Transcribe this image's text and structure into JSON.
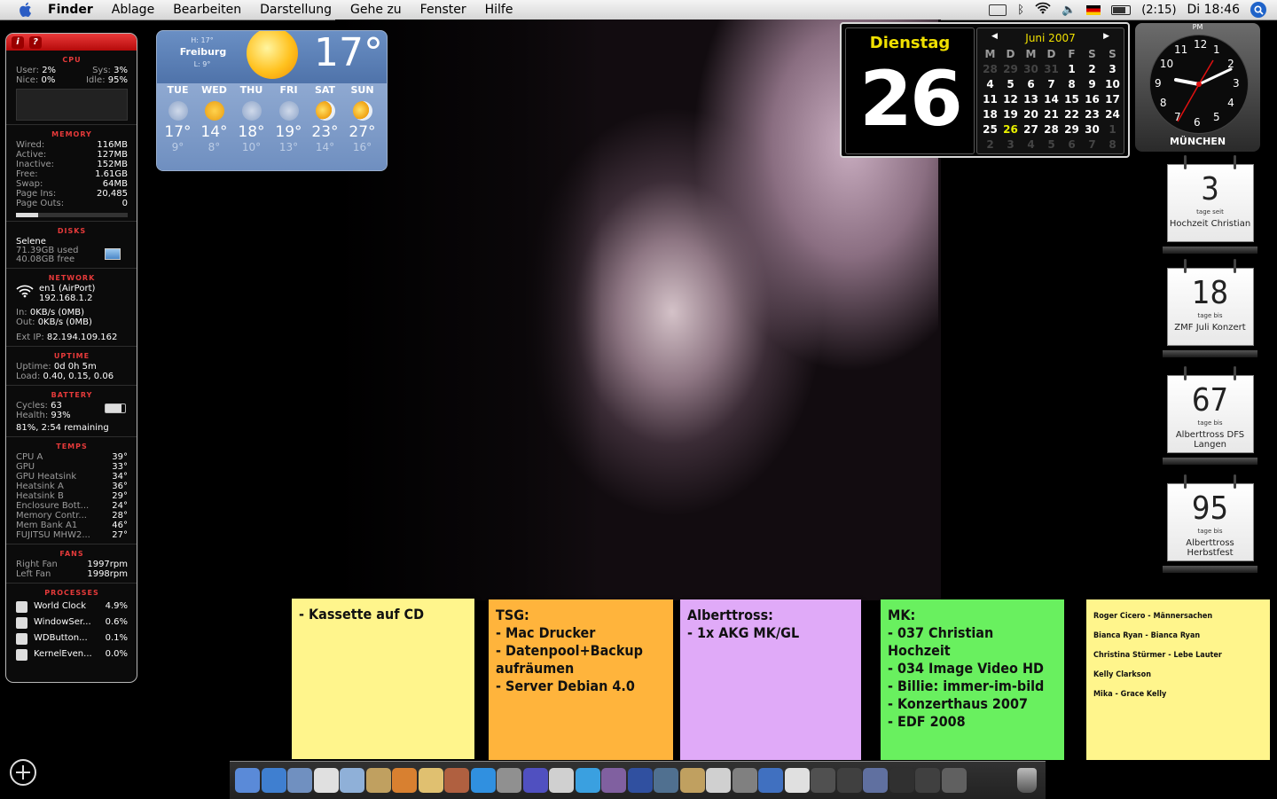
{
  "menubar": {
    "items": [
      "Finder",
      "Ablage",
      "Bearbeiten",
      "Darstellung",
      "Gehe zu",
      "Fenster",
      "Hilfe"
    ],
    "battery_time": "(2:15)",
    "clock": "Di 18:46"
  },
  "istat": {
    "cpu": {
      "title": "CPU",
      "user_label": "User:",
      "user": "2%",
      "sys_label": "Sys:",
      "sys": "3%",
      "nice_label": "Nice:",
      "nice": "0%",
      "idle_label": "Idle:",
      "idle": "95%"
    },
    "memory": {
      "title": "MEMORY",
      "rows": [
        {
          "label": "Wired:",
          "value": "116MB"
        },
        {
          "label": "Active:",
          "value": "127MB"
        },
        {
          "label": "Inactive:",
          "value": "152MB"
        },
        {
          "label": "Free:",
          "value": "1.61GB"
        },
        {
          "label": "Swap:",
          "value": "64MB"
        },
        {
          "label": "Page Ins:",
          "value": "20,485"
        },
        {
          "label": "Page Outs:",
          "value": "0"
        }
      ],
      "usage_fraction": 0.2
    },
    "disks": {
      "title": "DISKS",
      "name": "Selene",
      "used": "71.39GB used",
      "free": "40.08GB free"
    },
    "network": {
      "title": "NETWORK",
      "iface": "en1 (AirPort)",
      "ip": "192.168.1.2",
      "in_label": "In:",
      "in": "0KB/s (0MB)",
      "out_label": "Out:",
      "out": "0KB/s (0MB)",
      "ext_label": "Ext IP:",
      "ext": "82.194.109.162"
    },
    "uptime": {
      "title": "UPTIME",
      "uptime_label": "Uptime:",
      "uptime": "0d 0h 5m",
      "load_label": "Load:",
      "load": "0.40, 0.15, 0.06"
    },
    "battery": {
      "title": "BATTERY",
      "cycles_label": "Cycles:",
      "cycles": "63",
      "health_label": "Health:",
      "health": "93%",
      "remaining": "81%, 2:54 remaining"
    },
    "temps": {
      "title": "TEMPS",
      "rows": [
        {
          "label": "CPU A",
          "value": "39°"
        },
        {
          "label": "GPU",
          "value": "33°"
        },
        {
          "label": "GPU Heatsink",
          "value": "34°"
        },
        {
          "label": "Heatsink A",
          "value": "36°"
        },
        {
          "label": "Heatsink B",
          "value": "29°"
        },
        {
          "label": "Enclosure Bott...",
          "value": "24°"
        },
        {
          "label": "Memory Contr...",
          "value": "28°"
        },
        {
          "label": "Mem Bank A1",
          "value": "46°"
        },
        {
          "label": "FUJITSU MHW2...",
          "value": "27°"
        }
      ]
    },
    "fans": {
      "title": "FANS",
      "rows": [
        {
          "label": "Right Fan",
          "value": "1997rpm"
        },
        {
          "label": "Left Fan",
          "value": "1998rpm"
        }
      ]
    },
    "processes": {
      "title": "PROCESSES",
      "rows": [
        {
          "label": "World Clock",
          "value": "4.9%"
        },
        {
          "label": "WindowSer...",
          "value": "0.6%"
        },
        {
          "label": "WDButton...",
          "value": "0.1%"
        },
        {
          "label": "KernelEven...",
          "value": "0.0%"
        }
      ]
    }
  },
  "weather": {
    "high": "H: 17°",
    "city": "Freiburg",
    "low": "L: 9°",
    "current": "17°",
    "days": [
      {
        "name": "TUE",
        "hi": "17°",
        "lo": "9°",
        "icon": "rain-icon"
      },
      {
        "name": "WED",
        "hi": "14°",
        "lo": "8°",
        "icon": "sun-rain-icon"
      },
      {
        "name": "THU",
        "hi": "18°",
        "lo": "10°",
        "icon": "rain-icon"
      },
      {
        "name": "FRI",
        "hi": "19°",
        "lo": "13°",
        "icon": "rain-icon"
      },
      {
        "name": "SAT",
        "hi": "23°",
        "lo": "14°",
        "icon": "partly-cloudy-icon"
      },
      {
        "name": "SUN",
        "hi": "27°",
        "lo": "16°",
        "icon": "partly-cloudy-icon"
      }
    ]
  },
  "calendar": {
    "dayname": "Dienstag",
    "daynum": "26",
    "month": "Juni 2007",
    "headers": [
      "M",
      "D",
      "M",
      "D",
      "F",
      "S",
      "S"
    ],
    "weeks": [
      [
        "28",
        "29",
        "30",
        "31",
        "1",
        "2",
        "3"
      ],
      [
        "4",
        "5",
        "6",
        "7",
        "8",
        "9",
        "10"
      ],
      [
        "11",
        "12",
        "13",
        "14",
        "15",
        "16",
        "17"
      ],
      [
        "18",
        "19",
        "20",
        "21",
        "22",
        "23",
        "24"
      ],
      [
        "25",
        "26",
        "27",
        "28",
        "29",
        "30",
        "1"
      ],
      [
        "2",
        "3",
        "4",
        "5",
        "6",
        "7",
        "8"
      ]
    ]
  },
  "clock": {
    "ampm": "PM",
    "city": "MÜNCHEN",
    "numbers": [
      "12",
      "1",
      "2",
      "3",
      "4",
      "5",
      "6",
      "7",
      "8",
      "9",
      "10",
      "11"
    ]
  },
  "countdowns": [
    {
      "number": "3",
      "sub": "tage seit",
      "label": "Hochzeit Christian"
    },
    {
      "number": "18",
      "sub": "tage bis",
      "label": "ZMF Juli Konzert"
    },
    {
      "number": "67",
      "sub": "tage bis",
      "label": "Alberttross DFS Langen"
    },
    {
      "number": "95",
      "sub": "tage bis",
      "label": "Alberttross Herbstfest"
    }
  ],
  "stickies": [
    {
      "text": "- Kassette auf CD",
      "color": "#fff58c"
    },
    {
      "text": "TSG:\n- Mac Drucker\n- Datenpool+Backup\naufräumen\n- Server Debian 4.0",
      "color": "#ffb43c"
    },
    {
      "text": "Alberttross:\n- 1x AKG MK/GL",
      "color": "#e0aaf8"
    },
    {
      "text": "MK:\n- 037 Christian Hochzeit\n- 034 Image Video HD\n- Billie: immer-im-bild\n- Konzerthaus 2007\n- EDF 2008",
      "color": "#69f05f"
    },
    {
      "text": "Roger Cicero - Männersachen\nBianca Ryan - Bianca Ryan\nChristina Stürmer - Lebe Lauter\nKelly Clarkson\nMika - Grace Kelly",
      "color": "#fff58c"
    }
  ]
}
